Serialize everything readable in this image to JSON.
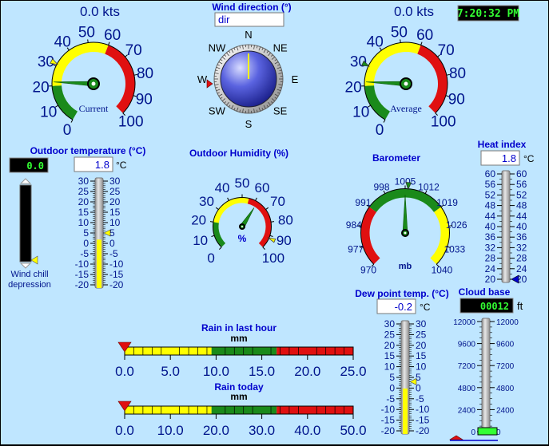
{
  "wind_current": {
    "speed": "0.0 kts",
    "label": "Current",
    "ticks": [
      "0",
      "10",
      "20",
      "30",
      "40",
      "50",
      "60",
      "70",
      "80",
      "90",
      "100"
    ],
    "value": 0
  },
  "wind_average": {
    "speed": "0.0 kts",
    "label": "Average",
    "ticks": [
      "0",
      "10",
      "20",
      "30",
      "40",
      "50",
      "60",
      "70",
      "80",
      "90",
      "100"
    ],
    "value": 0
  },
  "clock": "7:20:32 PM",
  "wind_direction": {
    "title": "Wind direction (°)",
    "value": "dir",
    "points": [
      "N",
      "NE",
      "E",
      "SE",
      "S",
      "SW",
      "W",
      "NW"
    ],
    "degrees": 0
  },
  "outdoor_temp": {
    "title": "Outdoor temperature (°C)",
    "value": "1.8",
    "unit": "°C",
    "ticks": [
      "30",
      "25",
      "20",
      "15",
      "10",
      "5",
      "0",
      "-5",
      "-10",
      "-15",
      "-20"
    ],
    "level": 1.8
  },
  "wind_chill": {
    "value": "0.0",
    "label_line1": "Wind chill",
    "label_line2": "depression"
  },
  "humidity": {
    "title": "Outdoor Humidity (%)",
    "unit": "%",
    "ticks": [
      "0",
      "10",
      "20",
      "30",
      "40",
      "50",
      "60",
      "70",
      "80",
      "90",
      "100"
    ],
    "value": 62
  },
  "barometer": {
    "title": "Barometer",
    "unit": "mb",
    "ticks": [
      "970",
      "977",
      "984",
      "991",
      "998",
      "1005",
      "1012",
      "1019",
      "1026",
      "1033",
      "1040"
    ],
    "value": 1005
  },
  "heat_index": {
    "title": "Heat index",
    "value": "1.8",
    "unit": "°C",
    "ticks": [
      "60",
      "56",
      "52",
      "48",
      "44",
      "40",
      "36",
      "32",
      "28",
      "24",
      "20"
    ]
  },
  "rain_hour": {
    "title": "Rain in last hour",
    "unit": "mm",
    "ticks": [
      "0.0",
      "5.0",
      "10.0",
      "15.0",
      "20.0",
      "25.0"
    ],
    "value": 0
  },
  "rain_today": {
    "title": "Rain today",
    "unit": "mm",
    "ticks": [
      "0.0",
      "10.0",
      "20.0",
      "30.0",
      "40.0",
      "50.0"
    ],
    "value": 0
  },
  "dew_point": {
    "title": "Dew point temp. (°C)",
    "value": "-0.2",
    "unit": "°C",
    "ticks": [
      "30",
      "25",
      "20",
      "15",
      "10",
      "5",
      "0",
      "-5",
      "-10",
      "-15",
      "-20"
    ],
    "level": -0.2
  },
  "cloud_base": {
    "title": "Cloud base",
    "value": "00012",
    "unit": "ft",
    "ticks": [
      "12000",
      "9600",
      "7200",
      "4800",
      "2400",
      "0"
    ],
    "level": 12
  },
  "colors": {
    "background": "#bfe6ff",
    "gauge_green": "#1a8a1a",
    "gauge_yellow": "#ffff00",
    "gauge_red": "#e01010",
    "label_blue": "#0000cc",
    "lcd_green": "#33ff33"
  }
}
